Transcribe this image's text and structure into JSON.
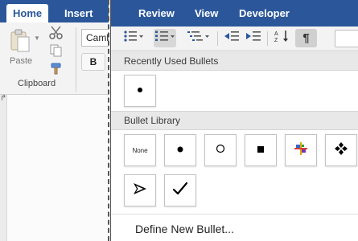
{
  "ribbon_left": {
    "tabs": [
      {
        "label": "Home"
      },
      {
        "label": "Insert"
      }
    ],
    "paste_label": "Paste",
    "clipboard_label": "Clipboard",
    "font_name": "Camb",
    "bold_label": "B"
  },
  "ribbon_right": {
    "tabs": [
      {
        "label": "Review"
      },
      {
        "label": "View"
      },
      {
        "label": "Developer"
      }
    ],
    "toolbar_icons": [
      "bullets-icon",
      "numbering-icon",
      "multilevel-list-icon",
      "decrease-indent-icon",
      "increase-indent-icon",
      "sort-icon",
      "pilcrow-icon"
    ],
    "pilcrow": "¶"
  },
  "bullets_menu": {
    "recent_header": "Recently Used Bullets",
    "recent": [
      {
        "symbol": "•",
        "name": "filled-circle"
      }
    ],
    "library_header": "Bullet Library",
    "library": [
      {
        "symbol": "None",
        "name": "none"
      },
      {
        "symbol": "●",
        "name": "filled-circle"
      },
      {
        "symbol": "○",
        "name": "hollow-circle"
      },
      {
        "symbol": "■",
        "name": "filled-square"
      },
      {
        "symbol": "✦",
        "name": "color-star"
      },
      {
        "symbol": "❖",
        "name": "four-diamond"
      },
      {
        "symbol": "➤",
        "name": "arrowhead"
      },
      {
        "symbol": "✓",
        "name": "checkmark"
      }
    ],
    "define_label": "Define New Bullet..."
  },
  "colors": {
    "ribbon_blue": "#2b579a",
    "selected_gray": "#d7d7d7",
    "section_header_bg": "#e8e8e8"
  }
}
